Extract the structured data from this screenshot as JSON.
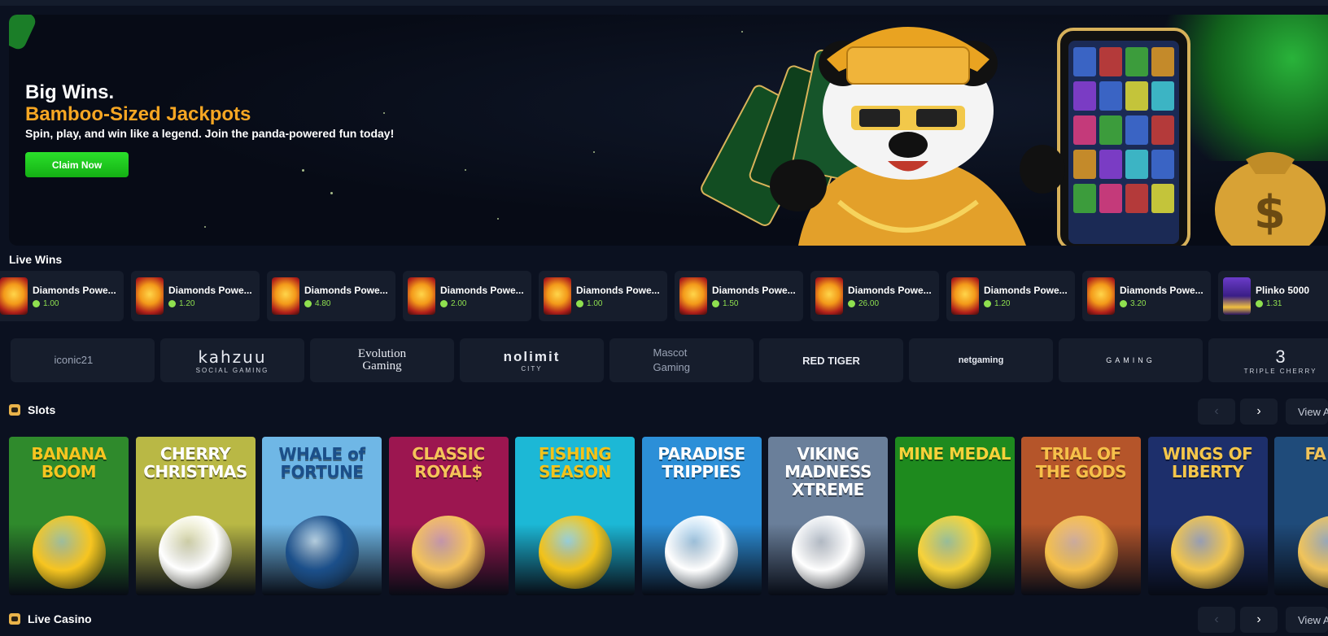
{
  "hero": {
    "title_line1": "Big Wins.",
    "title_line2": "Bamboo-Sized Jackpots",
    "subtitle": "Spin, play, and win like a legend. Join the panda-powered fun today!",
    "cta_label": "Claim Now"
  },
  "live_wins": {
    "title": "Live Wins",
    "items": [
      {
        "name": "Diamonds Powe...",
        "amount": "1.00"
      },
      {
        "name": "Diamonds Powe...",
        "amount": "1.20"
      },
      {
        "name": "Diamonds Powe...",
        "amount": "4.80"
      },
      {
        "name": "Diamonds Powe...",
        "amount": "2.00"
      },
      {
        "name": "Diamonds Powe...",
        "amount": "1.00"
      },
      {
        "name": "Diamonds Powe...",
        "amount": "1.50"
      },
      {
        "name": "Diamonds Powe...",
        "amount": "26.00"
      },
      {
        "name": "Diamonds Powe...",
        "amount": "1.20"
      },
      {
        "name": "Diamonds Powe...",
        "amount": "3.20"
      },
      {
        "name": "Plinko 5000",
        "amount": "1.31"
      }
    ]
  },
  "providers": [
    {
      "label": "iconic21",
      "broken": true
    },
    {
      "label": "kahzuu",
      "sub": "SOCIAL GAMING"
    },
    {
      "label": "Evolution Gaming"
    },
    {
      "label": "nolimit",
      "sub": "CITY"
    },
    {
      "label": "Mascot Gaming",
      "broken": true
    },
    {
      "label": "RED TIGER"
    },
    {
      "label": "netgaming"
    },
    {
      "label": "GAMING"
    },
    {
      "label": "3",
      "sub": "TRIPLE CHERRY"
    }
  ],
  "slots": {
    "title": "Slots",
    "view_all": "View A",
    "prev": "‹",
    "next": "›",
    "games": [
      {
        "title": "BANANA BOOM",
        "bg": "#2f8a2c",
        "color": "#f7c520"
      },
      {
        "title": "CHERRY CHRISTMAS",
        "bg": "#b9b845",
        "color": "#ffffff"
      },
      {
        "title": "WHALE of FORTUNE",
        "bg": "#6fb7e6",
        "color": "#1b4f8a"
      },
      {
        "title": "CLASSIC ROYAL$",
        "bg": "#9c1650",
        "color": "#f5c35a"
      },
      {
        "title": "FISHING SEASON",
        "bg": "#1cb8d6",
        "color": "#f2c21a"
      },
      {
        "title": "PARADISE TRIPPIES",
        "bg": "#2c8fd8",
        "color": "#ffffff"
      },
      {
        "title": "VIKING MADNESS XTREME",
        "bg": "#6a7f9a",
        "color": "#ffffff"
      },
      {
        "title": "MINE MEDAL",
        "bg": "#1e8a1e",
        "color": "#f7d23a"
      },
      {
        "title": "TRIAL OF THE GODS",
        "bg": "#b5552a",
        "color": "#f6c04a"
      },
      {
        "title": "WINGS OF LIBERTY",
        "bg": "#1d2f6b",
        "color": "#f4c64a"
      },
      {
        "title": "FA OLY",
        "bg": "#1f4b7a",
        "color": "#f1c45a"
      }
    ]
  },
  "live_casino": {
    "title": "Live Casino",
    "view_all": "View A",
    "prev": "‹",
    "next": "›"
  }
}
